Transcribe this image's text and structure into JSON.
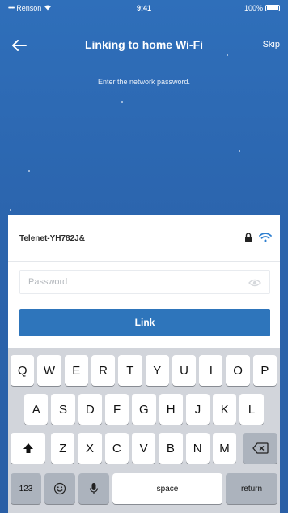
{
  "status_bar": {
    "carrier": "Renson",
    "signal": "•••••",
    "time": "9:41",
    "battery": "100%"
  },
  "nav": {
    "title": "Linking to home Wi-Fi",
    "skip_label": "Skip"
  },
  "instruction": "Enter the network password.",
  "network": {
    "name": "Telenet-YH782J&"
  },
  "password_field": {
    "placeholder": "Password",
    "value": ""
  },
  "link_button_label": "Link",
  "keyboard": {
    "row1": [
      "Q",
      "W",
      "E",
      "R",
      "T",
      "Y",
      "U",
      "I",
      "O",
      "P"
    ],
    "row2": [
      "A",
      "S",
      "D",
      "F",
      "G",
      "H",
      "J",
      "K",
      "L"
    ],
    "row3": [
      "Z",
      "X",
      "C",
      "V",
      "B",
      "N",
      "M"
    ],
    "numbers_label": "123",
    "space_label": "space",
    "return_label": "return"
  },
  "colors": {
    "background": "#2b64ad",
    "accent": "#2e75bb",
    "keyboard_bg": "#d2d5db"
  }
}
